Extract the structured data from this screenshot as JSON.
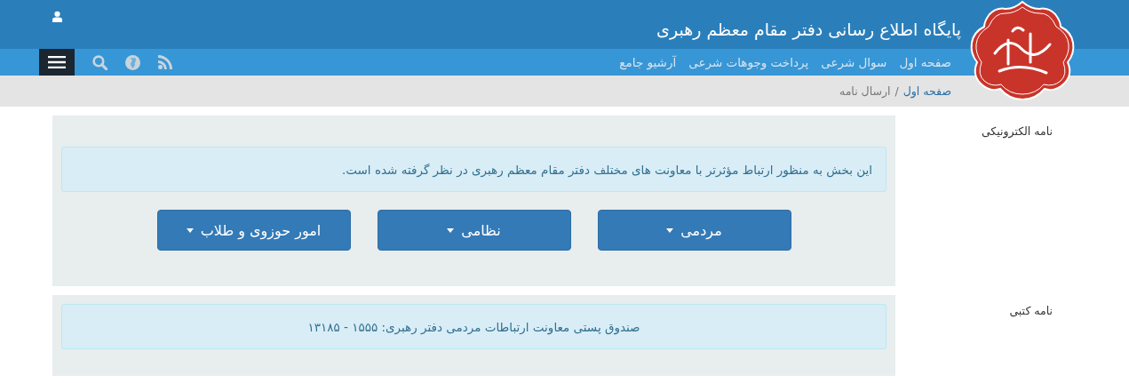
{
  "header": {
    "title": "پایگاه اطلاع رسانی دفتر مقام معظم رهبری"
  },
  "nav": {
    "links": [
      "صفحه اول",
      "سوال شرعی",
      "پرداخت وجوهات شرعی",
      "آرشیو جامع"
    ]
  },
  "breadcrumb": {
    "separator": "/",
    "items": [
      {
        "label": "صفحه اول",
        "kind": "link"
      },
      {
        "label": "ارسال نامه",
        "kind": "current"
      }
    ]
  },
  "sections": [
    {
      "label": "نامه الکترونیکی",
      "kind": "menu",
      "message": "این بخش به منظور ارتباط مؤثرتر با معاونت های مختلف دفتر مقام معظم رهبری در نظر گرفته شده است.",
      "buttons": [
        "مردمی",
        "نظامی",
        "امور حوزوی و طلاب"
      ]
    },
    {
      "label": "نامه کتبی",
      "kind": "info",
      "message": "صندوق پستی معاونت ارتباطات مردمی دفتر رهبری: ۱۵۵۵ - ۱۳۱۸۵"
    }
  ]
}
